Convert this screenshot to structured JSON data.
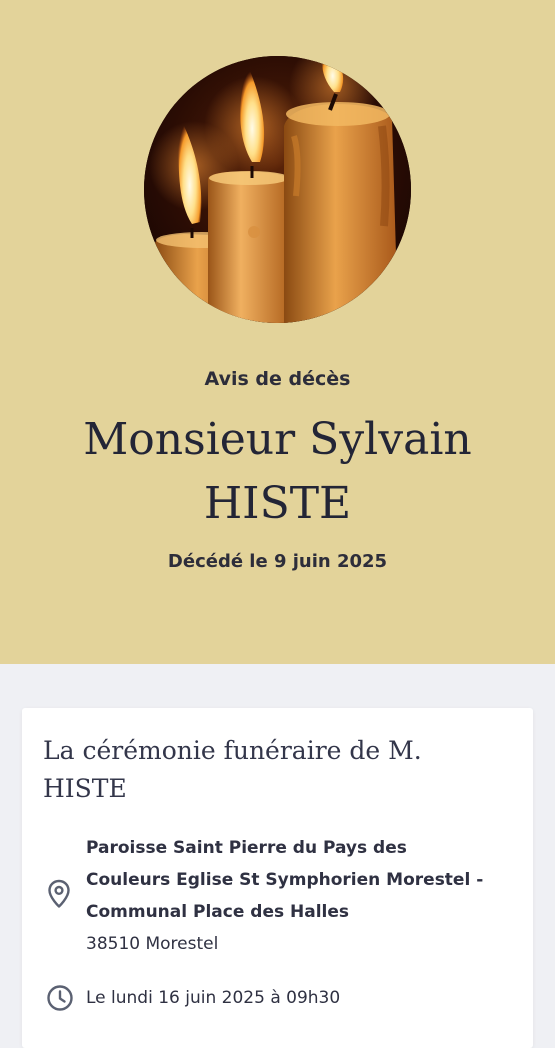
{
  "hero": {
    "kicker": "Avis de décès",
    "name_line1": "Monsieur Sylvain",
    "name_line2": "HISTE",
    "death_date": "Décédé le 9 juin 2025",
    "photo_icon": "candles-photo",
    "background_color": "#e3d39a"
  },
  "ceremony": {
    "title_line1": "La cérémonie funéraire de M.",
    "title_line2": "HISTE",
    "location_icon": "map-pin-icon",
    "place_line1": "Paroisse Saint Pierre du Pays des",
    "place_line2": "Couleurs Eglise St Symphorien Morestel -",
    "place_line3": "Communal Place des Halles",
    "city": "38510 Morestel",
    "time_icon": "clock-icon",
    "datetime": "Le lundi 16 juin 2025 à 09h30"
  }
}
